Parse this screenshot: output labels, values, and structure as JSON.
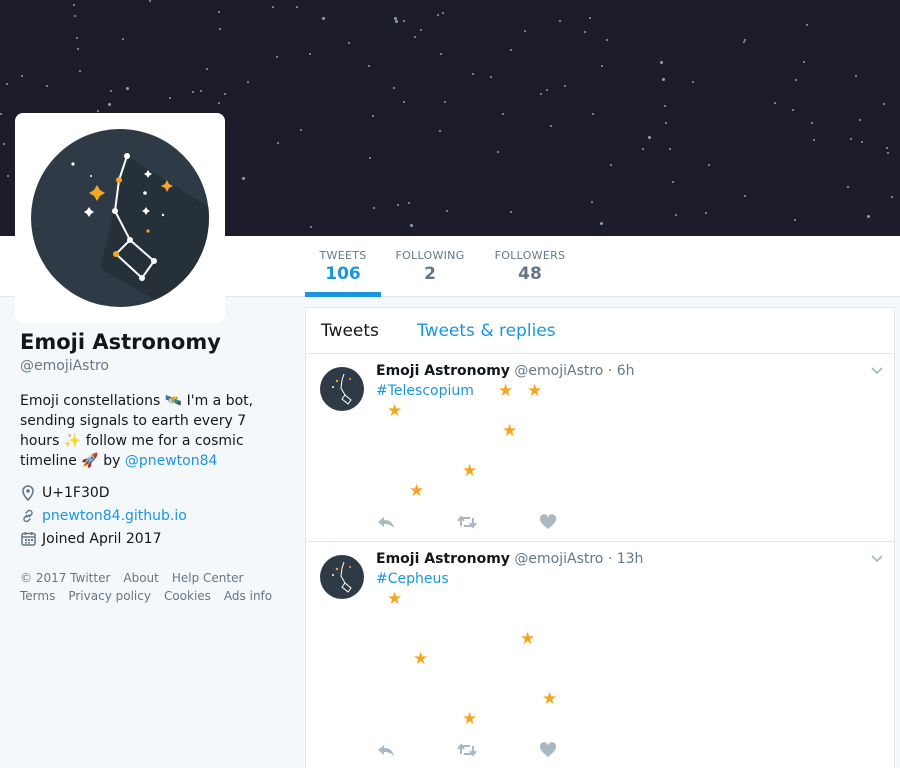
{
  "profile": {
    "name": "Emoji Astronomy",
    "handle": "@emojiAstro",
    "bio_text": "Emoji constellations 🛰️ I'm a bot, sending signals to earth every 7 hours ✨ follow me for a cosmic timeline 🚀 by ",
    "bio_link": "@pnewton84",
    "location": "U+1F30D",
    "website": "pnewton84.github.io",
    "joined": "Joined April 2017"
  },
  "stats": [
    {
      "label": "TWEETS",
      "value": "106"
    },
    {
      "label": "FOLLOWING",
      "value": "2"
    },
    {
      "label": "FOLLOWERS",
      "value": "48"
    }
  ],
  "footer": {
    "copyright": "© 2017 Twitter",
    "about": "About",
    "help": "Help Center",
    "terms": "Terms",
    "privacy": "Privacy policy",
    "cookies": "Cookies",
    "ads": "Ads info"
  },
  "timeline": {
    "tab_tweets": "Tweets",
    "tab_replies": "Tweets & replies",
    "tweets": [
      {
        "name": "Emoji Astronomy",
        "handle": "@emojiAstro",
        "dot": "·",
        "time": "6h",
        "tag": "#Telescopium",
        "star": "★"
      },
      {
        "name": "Emoji Astronomy",
        "handle": "@emojiAstro",
        "dot": "·",
        "time": "13h",
        "tag": "#Cepheus",
        "star": "★"
      }
    ]
  },
  "icons": {
    "location": "map-pin-icon",
    "website": "link-icon",
    "joined": "calendar-icon",
    "reply": "reply-icon",
    "retweet": "retweet-icon",
    "like": "heart-icon",
    "caret": "chevron-down-icon"
  },
  "colors": {
    "accent": "#1b95e0",
    "star": "#f5a623",
    "banner": "#1d1c2b",
    "avatar_bg": "#2f3a47"
  }
}
